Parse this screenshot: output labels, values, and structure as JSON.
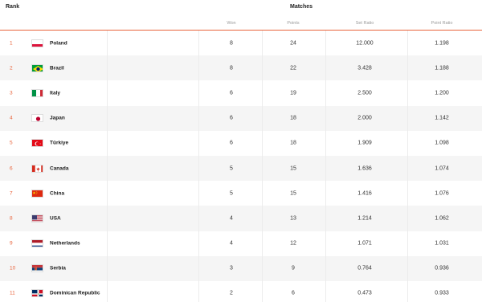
{
  "headers": {
    "rank": "Rank",
    "matches": "Matches",
    "won": "Won",
    "points": "Points",
    "set_ratio": "Set Ratio",
    "point_ratio": "Point Ratio"
  },
  "colors": {
    "accent": "#e9643c",
    "alt_row": "#f5f5f5"
  },
  "rows": [
    {
      "rank": "1",
      "country": "Poland",
      "flag": "poland-flag-icon",
      "won": "8",
      "points": "24",
      "set_ratio": "12.000",
      "point_ratio": "1.198"
    },
    {
      "rank": "2",
      "country": "Brazil",
      "flag": "brazil-flag-icon",
      "won": "8",
      "points": "22",
      "set_ratio": "3.428",
      "point_ratio": "1.188"
    },
    {
      "rank": "3",
      "country": "Italy",
      "flag": "italy-flag-icon",
      "won": "6",
      "points": "19",
      "set_ratio": "2.500",
      "point_ratio": "1.200"
    },
    {
      "rank": "4",
      "country": "Japan",
      "flag": "japan-flag-icon",
      "won": "6",
      "points": "18",
      "set_ratio": "2.000",
      "point_ratio": "1.142"
    },
    {
      "rank": "5",
      "country": "Türkiye",
      "flag": "turkiye-flag-icon",
      "won": "6",
      "points": "18",
      "set_ratio": "1.909",
      "point_ratio": "1.098"
    },
    {
      "rank": "6",
      "country": "Canada",
      "flag": "canada-flag-icon",
      "won": "5",
      "points": "15",
      "set_ratio": "1.636",
      "point_ratio": "1.074"
    },
    {
      "rank": "7",
      "country": "China",
      "flag": "china-flag-icon",
      "won": "5",
      "points": "15",
      "set_ratio": "1.416",
      "point_ratio": "1.076"
    },
    {
      "rank": "8",
      "country": "USA",
      "flag": "usa-flag-icon",
      "won": "4",
      "points": "13",
      "set_ratio": "1.214",
      "point_ratio": "1.062"
    },
    {
      "rank": "9",
      "country": "Netherlands",
      "flag": "netherlands-flag-icon",
      "won": "4",
      "points": "12",
      "set_ratio": "1.071",
      "point_ratio": "1.031"
    },
    {
      "rank": "10",
      "country": "Serbia",
      "flag": "serbia-flag-icon",
      "won": "3",
      "points": "9",
      "set_ratio": "0.764",
      "point_ratio": "0.936"
    },
    {
      "rank": "11",
      "country": "Dominican Republic",
      "flag": "dominican-republic-flag-icon",
      "won": "2",
      "points": "6",
      "set_ratio": "0.473",
      "point_ratio": "0.933"
    }
  ]
}
